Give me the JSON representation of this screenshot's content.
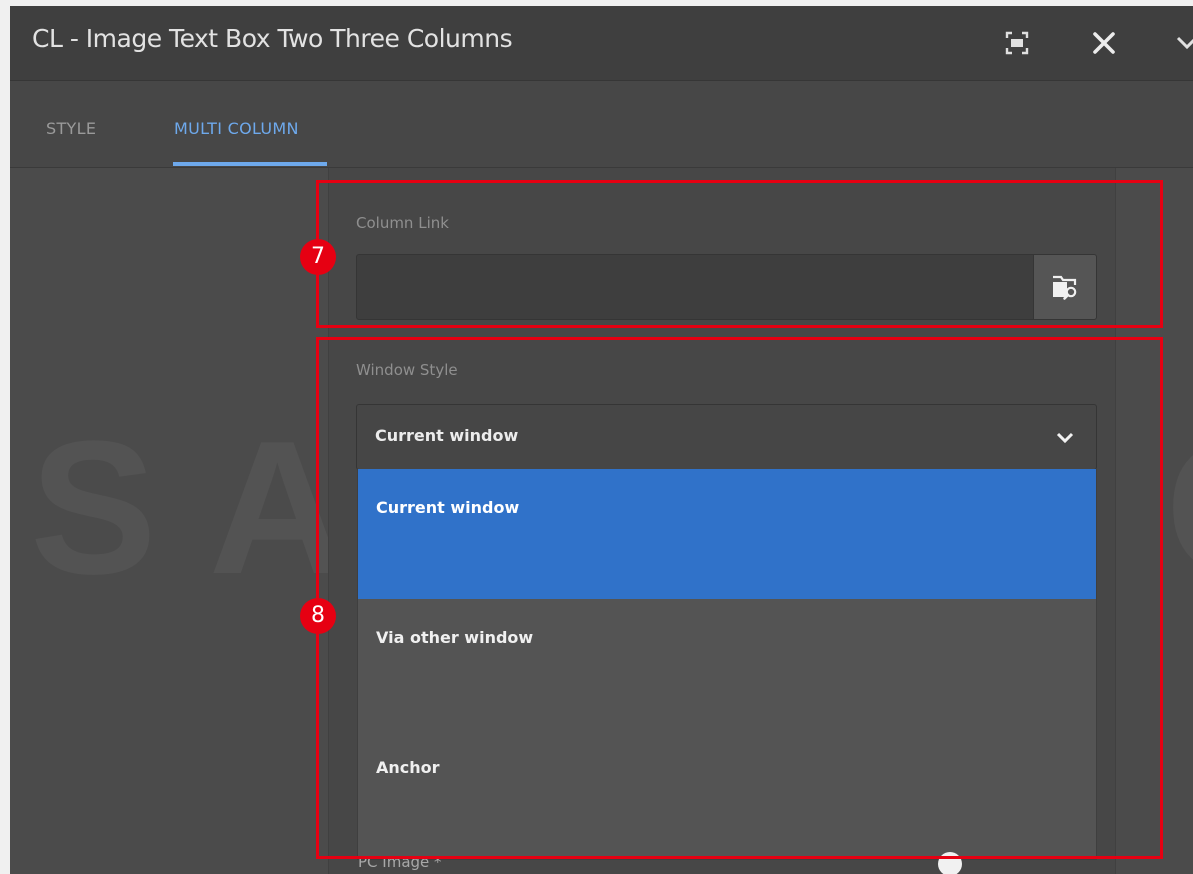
{
  "dialog": {
    "title": "CL - Image Text Box Two Three Columns",
    "icons": [
      "fullscreen-icon",
      "close-icon",
      "chevron-down-icon"
    ]
  },
  "tabs": [
    {
      "label": "STYLE",
      "active": false
    },
    {
      "label": "MULTI COLUMN",
      "active": true
    }
  ],
  "watermark": "SAMSUNG",
  "column_link": {
    "label": "Column Link",
    "value": "",
    "browse_icon": "folder-search-icon"
  },
  "window_style": {
    "label": "Window Style",
    "selected": "Current window",
    "options": [
      "Current window",
      "Via other window",
      "Anchor"
    ]
  },
  "next_field": {
    "label": "PC Image *",
    "icon": "info-icon"
  },
  "annotations": {
    "first": "7",
    "second": "8"
  },
  "colors": {
    "accent": "#6ea9ec",
    "selected_option": "#3072c9",
    "annotation": "#e60012"
  }
}
